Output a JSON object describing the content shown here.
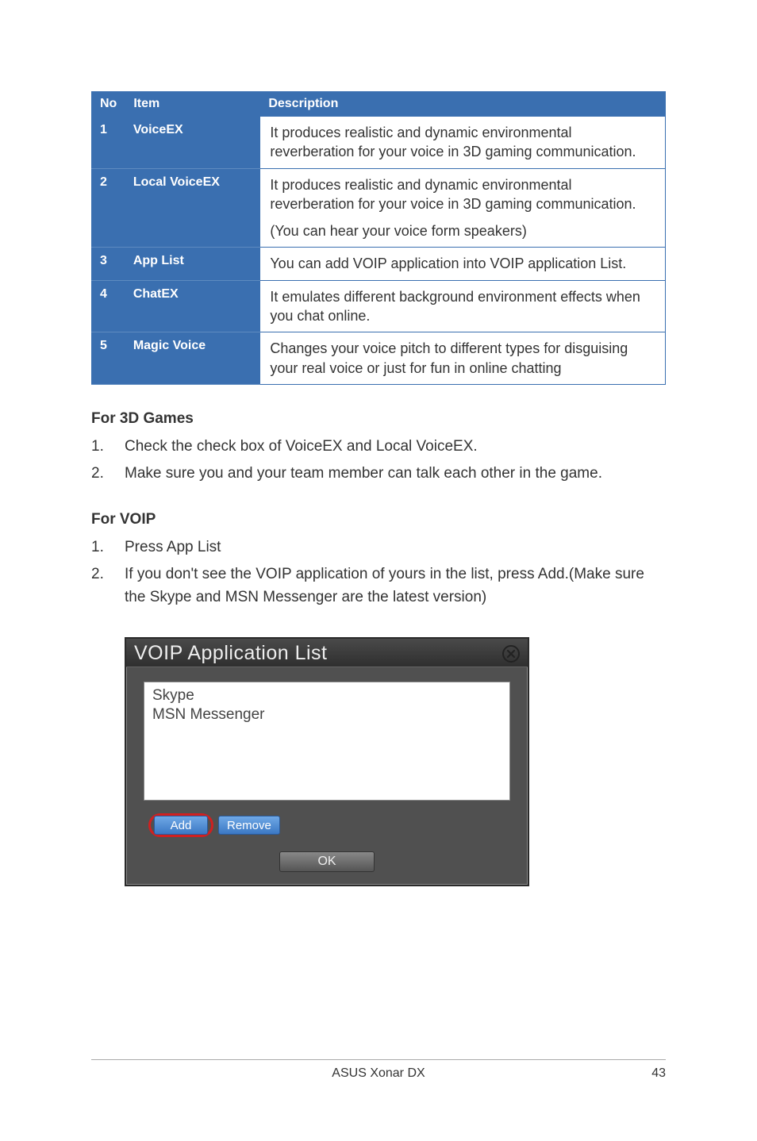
{
  "table": {
    "headers": {
      "no": "No",
      "item": "Item",
      "desc": "Description"
    },
    "rows": [
      {
        "no": "1",
        "item": "VoiceEX",
        "desc": "It produces realistic and dynamic environmental reverberation for your voice in 3D gaming communication."
      },
      {
        "no": "2",
        "item": "Local VoiceEX",
        "desc": "It produces realistic and dynamic environmental reverberation for your voice in 3D gaming communication.",
        "extra": "(You can hear your voice form speakers)"
      },
      {
        "no": "3",
        "item": "App List",
        "desc": "You can add VOIP application into VOIP application List."
      },
      {
        "no": "4",
        "item": "ChatEX",
        "desc": "It emulates different background environment effects when you chat online."
      },
      {
        "no": "5",
        "item": "Magic Voice",
        "desc": "Changes your voice pitch to different types for disguising your real voice or just for fun in online chatting"
      }
    ]
  },
  "sections": {
    "games_heading": "For 3D Games",
    "games_items": [
      {
        "num": "1.",
        "text": "Check the check box of VoiceEX and Local VoiceEX."
      },
      {
        "num": "2.",
        "text": "Make sure you and your team member can talk each other in the game."
      }
    ],
    "voip_heading": "For VOIP",
    "voip_items": [
      {
        "num": "1.",
        "text": "Press App List"
      },
      {
        "num": "2.",
        "text": "If you don't see the VOIP application of yours in the list, press Add.(Make sure the Skype and MSN Messenger are the latest version)"
      }
    ]
  },
  "dialog": {
    "title": "VOIP Application List",
    "items": [
      "Skype",
      "MSN Messenger"
    ],
    "add_label": "Add",
    "remove_label": "Remove",
    "ok_label": "OK"
  },
  "footer": {
    "product": "ASUS Xonar DX",
    "page": "43"
  }
}
